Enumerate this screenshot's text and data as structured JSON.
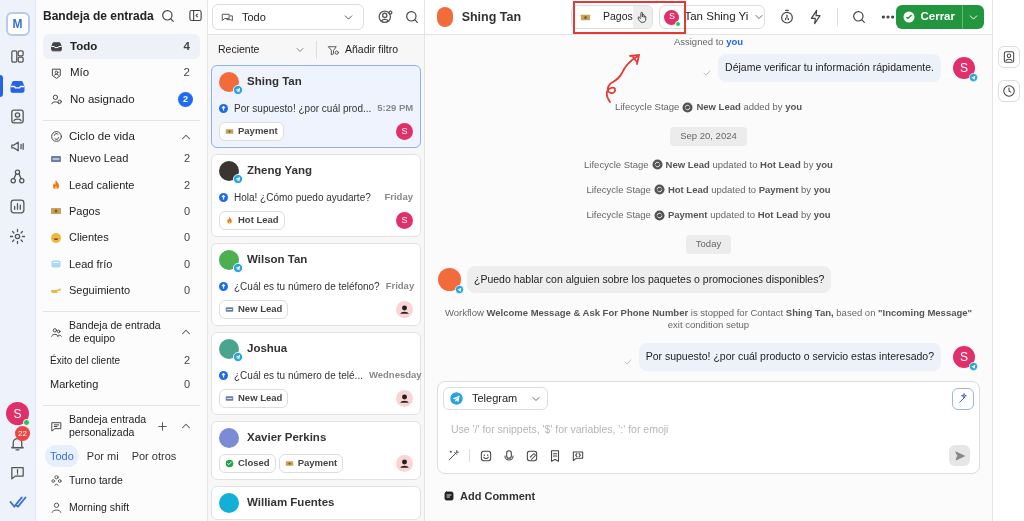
{
  "rail": {
    "logo": "M",
    "avatar": "S",
    "notifications": "22"
  },
  "sidebar": {
    "title": "Bandeja de entrada",
    "inbox_items": [
      {
        "label": "Todo",
        "count": "4",
        "selected": true,
        "badge": false,
        "kind": "all"
      },
      {
        "label": "Mío",
        "count": "2",
        "selected": false,
        "badge": false,
        "kind": "mine"
      },
      {
        "label": "No asignado",
        "count": "2",
        "selected": false,
        "badge": true,
        "kind": "unassigned"
      }
    ],
    "lifecycle": {
      "title": "Ciclo de vida",
      "expanded": true,
      "items": [
        {
          "label": "Nuevo Lead",
          "count": "2",
          "kind": "new"
        },
        {
          "label": "Lead caliente",
          "count": "2",
          "kind": "hot"
        },
        {
          "label": "Pagos",
          "count": "0",
          "kind": "payment"
        },
        {
          "label": "Clientes",
          "count": "0",
          "kind": "customer"
        },
        {
          "label": "Lead frío",
          "count": "0",
          "kind": "cold"
        },
        {
          "label": "Seguimiento",
          "count": "0",
          "kind": "followup"
        }
      ]
    },
    "team": {
      "title": "Bandeja de entrada de equipo",
      "expanded": true,
      "items": [
        {
          "label": "Éxito del cliente",
          "count": "2"
        },
        {
          "label": "Marketing",
          "count": "0"
        }
      ]
    },
    "custom": {
      "title": "Bandeja entrada personalizada",
      "expanded": true,
      "filters": [
        {
          "label": "Todo",
          "selected": true
        },
        {
          "label": "Por mi",
          "selected": false
        },
        {
          "label": "Por otros",
          "selected": false
        }
      ],
      "items": [
        {
          "label": "Turno tarde",
          "kind": "group"
        },
        {
          "label": "Morning shift",
          "kind": "single"
        }
      ]
    }
  },
  "conversation_list": {
    "filter": "Todo",
    "sort": "Reciente",
    "add_filter": "Añadir filtro",
    "conversations": [
      {
        "name": "Shing Tan",
        "color": "#f26b3a",
        "preview": "Por supuesto! ¿por cuál prod...",
        "time": "5:29 PM",
        "selected": true,
        "tags": [
          {
            "label": "Payment",
            "kind": "payment"
          }
        ],
        "assignee": {
          "kind": "agent",
          "initial": "S"
        }
      },
      {
        "name": "Zheng Yang",
        "color": "#3b3530",
        "preview": "Hola! ¿Cómo puedo ayudarte?",
        "time": "Friday",
        "selected": false,
        "tags": [
          {
            "label": "Hot Lead",
            "kind": "hot"
          }
        ],
        "assignee": {
          "kind": "agent",
          "initial": "S"
        }
      },
      {
        "name": "Wilson Tan",
        "color": "#4caf50",
        "preview": "¿Cuál es tu número de teléfono?",
        "time": "Friday",
        "selected": false,
        "tags": [
          {
            "label": "New Lead",
            "kind": "new"
          }
        ],
        "assignee": {
          "kind": "unassigned"
        }
      },
      {
        "name": "Joshua",
        "color": "#4aa58f",
        "preview": "¿Cuál es tu número de telé...",
        "time": "Wednesday",
        "selected": false,
        "tags": [
          {
            "label": "New Lead",
            "kind": "new"
          }
        ],
        "assignee": {
          "kind": "unassigned"
        }
      },
      {
        "name": "Xavier Perkins",
        "color": "#7c8bd6",
        "selected": false,
        "tags": [
          {
            "label": "Closed",
            "kind": "closed"
          },
          {
            "label": "Payment",
            "kind": "payment"
          }
        ],
        "assignee": {
          "kind": "unassigned"
        }
      },
      {
        "name": "William Fuentes",
        "color": "#12b0d6",
        "selected": false
      }
    ]
  },
  "chat": {
    "contact": "Shing Tan",
    "stage": "Pagos",
    "assignee": {
      "name": "Tan Shing Yi",
      "initial": "S"
    },
    "close": "Cerrar",
    "messages": [
      {
        "kind": "assign",
        "text": "Assigned to",
        "actor": "you"
      },
      {
        "kind": "outgoing",
        "text": "Déjame verificar tu información rápidamente.",
        "avatar": "S"
      },
      {
        "kind": "stage",
        "label": "Lifecycle Stage",
        "text": "**New Lead** added by",
        "actor": "you"
      },
      {
        "kind": "date",
        "text": "Sep 20, 2024"
      },
      {
        "kind": "stage",
        "label": "Lifecycle Stage",
        "text": "**New Lead** updated to **Hot Lead** by",
        "actor": "you"
      },
      {
        "kind": "stage",
        "label": "Lifecycle Stage",
        "text": "**Hot Lead** updated to **Payment** by",
        "actor": "you"
      },
      {
        "kind": "stage",
        "label": "Lifecycle Stage",
        "text": "**Payment** updated to **Hot Lead** by",
        "actor": "you"
      },
      {
        "kind": "date",
        "text": "Today"
      },
      {
        "kind": "incoming",
        "text": "¿Puedo hablar con alguien sobre los paquetes o promociones disponibles?"
      },
      {
        "kind": "workflow",
        "text": "Workflow **Welcome Message & Ask For Phone Number** is stopped for Contact",
        "actor": "Shing Tan,",
        "rest": "based on **\"Incoming Message\"** exit condition setup"
      },
      {
        "kind": "outgoing",
        "text": "Por supuesto! ¿por cuál producto o servicio estas interesado?",
        "avatar": "S"
      }
    ],
    "composer": {
      "channel": "Telegram",
      "placeholder": "Use '/' for snippets, '$' for variables, ':' for emoji"
    },
    "add_comment": "Add Comment"
  }
}
